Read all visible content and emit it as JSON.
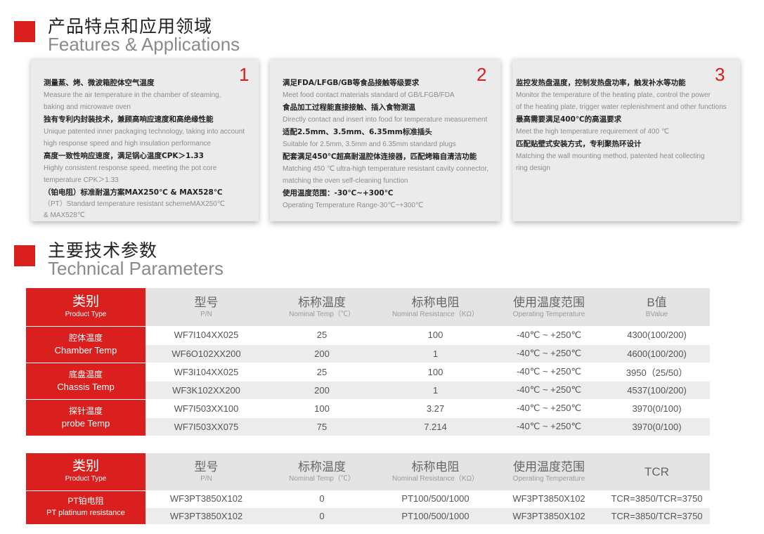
{
  "features": {
    "title_zh": "产品特点和应用领域",
    "title_en": "Features & Applications",
    "cards": [
      {
        "num": "1",
        "lines": [
          {
            "zh": "测量蒸、烤、微波箱腔体空气温度",
            "en": [
              "Measure the air temperature in the chamber of steaming,",
              "baking and microwave oven"
            ]
          },
          {
            "zh": "独有专利内封装技术，兼顾高响应速度和高绝缘性能",
            "en": [
              "Unique patented inner packaging technology, taking into account",
              "high response speed and high insulation performance"
            ]
          },
          {
            "zh": "高度一致性响应速度，满足锅心温度CPK＞1.33",
            "en": [
              "Highly consistent response speed, meeting the pot core",
              "temperature CPK＞1.33"
            ]
          },
          {
            "zh": "（铂电阻）标准耐温方案MAX250℃ & MAX528℃",
            "en": [
              "（PT）Standard temperature resistant schemeMAX250℃",
              "& MAX528℃"
            ]
          }
        ]
      },
      {
        "num": "2",
        "lines": [
          {
            "zh": "满足FDA/LFGB/GB等食品接触等级要求",
            "en": [
              "Meet food contact materials standard of GB/LFGB/FDA"
            ]
          },
          {
            "zh": "食品加工过程能直接接触、插入食物测温",
            "en": [
              "Directly contact and insert into food for temperature measurement"
            ]
          },
          {
            "zh": "适配2.5mm、3.5mm、6.35mm标准插头",
            "en": [
              "Suitable for 2.5mm, 3.5mm and 6.35mm standard plugs"
            ]
          },
          {
            "zh": "配套满足450℃超高耐温腔体连接器，匹配烤箱自清洁功能",
            "en": [
              "Matching 450 ℃ ultra-high temperature resistant cavity connector,",
              "matching the oven self-cleaning function"
            ]
          },
          {
            "zh": "使用温度范围：-30℃~+300℃",
            "en": [
              "Operating Temperature Range-30℃~+300℃"
            ]
          }
        ]
      },
      {
        "num": "3",
        "lines": [
          {
            "zh": "监控发热盘温度，控制发热盘功率，触发补水等功能",
            "en": [
              "Monitor the temperature of the heating plate, control the power",
              "of the heating plate, trigger water replenishment and other functions"
            ]
          },
          {
            "zh": "最高需要满足400℃的高温要求",
            "en": [
              "Meet the high temperature requirement of 400 ℃"
            ]
          },
          {
            "zh": "匹配贴壁式安装方式，专利聚热环设计",
            "en": [
              "Matching the wall mounting method, patented heat collecting",
              "ring design"
            ]
          }
        ]
      }
    ]
  },
  "technical": {
    "title_zh": "主要技术参数",
    "title_en": "Technical Parameters",
    "table1": {
      "category_header": {
        "zh": "类别",
        "en": "Product Type"
      },
      "columns": [
        {
          "zh": "型号",
          "en": "P/N"
        },
        {
          "zh": "标称温度",
          "en": "Nominal Temp（℃）"
        },
        {
          "zh": "标称电阻",
          "en": "Nominal Resistance（KΩ）"
        },
        {
          "zh": "使用温度范围",
          "en": "Operating Temperature"
        },
        {
          "zh": "B值",
          "en": "BValue"
        }
      ],
      "groups": [
        {
          "zh": "腔体温度",
          "en": "Chamber Temp",
          "rows": [
            [
              "WF7I104XX025",
              "25",
              "100",
              "-40℃ ~ +250℃",
              "4300(100/200)"
            ],
            [
              "WF6O102XX200",
              "200",
              "1",
              "-40℃ ~ +250℃",
              "4600(100/200)"
            ]
          ]
        },
        {
          "zh": "底盘温度",
          "en": "Chassis Temp",
          "rows": [
            [
              "WF3I104XX025",
              "25",
              "100",
              "-40℃ ~ +250℃",
              "3950（25/50）"
            ],
            [
              "WF3K102XX200",
              "200",
              "1",
              "-40℃ ~ +250℃",
              "4537(100/200)"
            ]
          ]
        },
        {
          "zh": "探针温度",
          "en": "probe Temp",
          "rows": [
            [
              "WF7I503XX100",
              "100",
              "3.27",
              "-40℃ ~ +250℃",
              "3970(0/100)"
            ],
            [
              "WF7I503XX075",
              "75",
              "7.214",
              "-40℃ ~ +250℃",
              "3970(0/100)"
            ]
          ]
        }
      ]
    },
    "table2": {
      "category_header": {
        "zh": "类别",
        "en": "Product Type"
      },
      "columns": [
        {
          "zh": "型号",
          "en": "P/N"
        },
        {
          "zh": "标称温度",
          "en": "Nominal Temp（℃）"
        },
        {
          "zh": "标称电阻",
          "en": "Nominal Resistance（KΩ）"
        },
        {
          "zh": "使用温度范围",
          "en": "Operating Temperature"
        },
        {
          "zh": "TCR",
          "en": ""
        }
      ],
      "groups": [
        {
          "zh": "PT铂电阻",
          "en": "PT platinum resistance",
          "rows": [
            [
              "WF3PT3850X102",
              "0",
              "PT100/500/1000",
              "WF3PT3850X102",
              "TCR=3850/TCR=3750"
            ],
            [
              "WF3PT3850X102",
              "0",
              "PT100/500/1000",
              "WF3PT3850X102",
              "TCR=3850/TCR=3750"
            ]
          ]
        }
      ]
    }
  },
  "colors": {
    "accent": "#d9201e",
    "card_bg": "#ebebeb",
    "header_bg": "#e4e4e4",
    "row_alt": "#ececec"
  }
}
